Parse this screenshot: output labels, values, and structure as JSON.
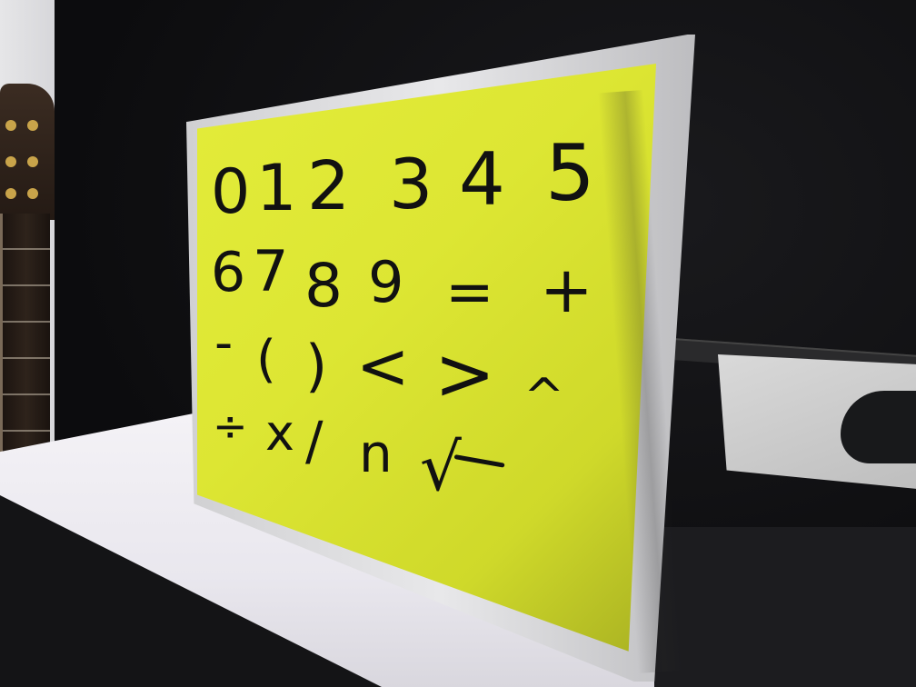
{
  "scene": {
    "board_color": "#dfe834",
    "frame_color": "#d6d6d8",
    "ink_color": "#111111"
  },
  "whiteboard": {
    "row1": [
      "0",
      "1",
      "2",
      "3",
      "4",
      "5"
    ],
    "row2": [
      "6",
      "7",
      "8",
      "9",
      "=",
      "+"
    ],
    "row3": [
      "-",
      "(",
      ")",
      "<",
      ">",
      "^"
    ],
    "row4": [
      "÷",
      "x",
      "/",
      "n",
      "√"
    ]
  }
}
